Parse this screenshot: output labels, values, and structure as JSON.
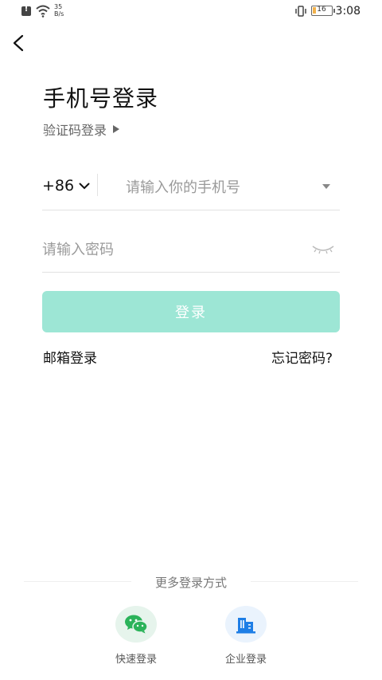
{
  "status_bar": {
    "net_speed_value": "35",
    "net_speed_unit": "B/s",
    "battery": "16",
    "battery_fraction": 0.16,
    "time": "3:08"
  },
  "header": {
    "title": "手机号登录",
    "switch_label": "验证码登录"
  },
  "form": {
    "country_code": "+86",
    "phone_placeholder": "请输入你的手机号",
    "password_placeholder": "请输入密码",
    "login_label": "登录"
  },
  "links": {
    "email_login": "邮箱登录",
    "forgot_password": "忘记密码?"
  },
  "more": {
    "label": "更多登录方式",
    "methods": [
      {
        "label": "快速登录",
        "icon": "wechat-icon",
        "color": "#2bb35a"
      },
      {
        "label": "企业登录",
        "icon": "building-icon",
        "color": "#1e7ee6"
      }
    ]
  },
  "colors": {
    "accent_disabled": "#9de6d5"
  }
}
